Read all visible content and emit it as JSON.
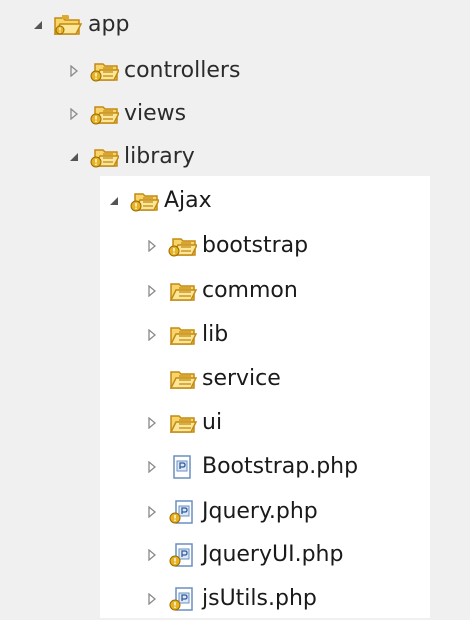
{
  "tree": {
    "app": {
      "label": "app",
      "expanded": true,
      "icon": "project-folder-icon"
    },
    "controllers": {
      "label": "controllers",
      "expanded": false,
      "icon": "package-warning-icon"
    },
    "views": {
      "label": "views",
      "expanded": false,
      "icon": "package-warning-icon"
    },
    "library": {
      "label": "library",
      "expanded": true,
      "icon": "package-warning-icon"
    },
    "ajax": {
      "label": "Ajax",
      "expanded": true,
      "icon": "package-warning-icon"
    },
    "bootstrap_folder": {
      "label": "bootstrap",
      "expanded": false,
      "icon": "package-warning-icon"
    },
    "common": {
      "label": "common",
      "expanded": false,
      "icon": "folder-icon"
    },
    "lib": {
      "label": "lib",
      "expanded": false,
      "icon": "folder-icon"
    },
    "service": {
      "label": "service",
      "icon": "folder-icon"
    },
    "ui": {
      "label": "ui",
      "expanded": false,
      "icon": "folder-icon"
    },
    "bootstrap_php": {
      "label": "Bootstrap.php",
      "expanded": false,
      "icon": "php-file-icon"
    },
    "jquery_php": {
      "label": "Jquery.php",
      "expanded": false,
      "icon": "php-file-warning-icon"
    },
    "jqueryui_php": {
      "label": "JqueryUI.php",
      "expanded": false,
      "icon": "php-file-warning-icon"
    },
    "jsutils_php": {
      "label": "jsUtils.php",
      "expanded": false,
      "icon": "php-file-warning-icon"
    }
  },
  "colors": {
    "folder_fill": "#f7d56a",
    "folder_stroke": "#c48a12",
    "warning": "#e6b422",
    "file_border": "#6a8fc0",
    "file_fill": "#ffffff",
    "toggle": "#8a8a8a"
  }
}
